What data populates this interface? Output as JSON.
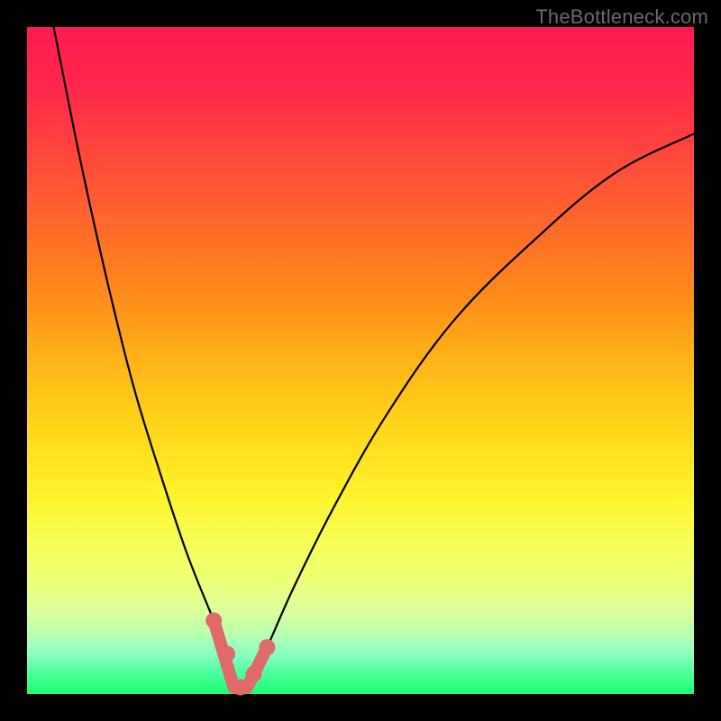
{
  "watermark": "TheBottleneck.com",
  "colors": {
    "background": "#000000",
    "curve": "#000000",
    "markers": "#e06a6a",
    "gradient_top": "#ff1a52",
    "gradient_mid": "#ffd61a",
    "gradient_bottom": "#1aff70"
  },
  "chart_data": {
    "type": "line",
    "title": "",
    "xlabel": "",
    "ylabel": "",
    "xlim": [
      0,
      100
    ],
    "ylim": [
      0,
      100
    ],
    "x_min_at": 32,
    "series": [
      {
        "name": "bottleneck-curve",
        "x": [
          4,
          8,
          12,
          16,
          20,
          24,
          28,
          30,
          32,
          34,
          36,
          40,
          46,
          54,
          64,
          76,
          88,
          100
        ],
        "values": [
          100,
          80,
          62,
          46,
          33,
          21,
          11,
          6,
          1,
          3,
          7,
          16,
          28,
          42,
          56,
          68,
          78,
          84
        ]
      }
    ],
    "markers": [
      {
        "x": 28,
        "y": 11
      },
      {
        "x": 30,
        "y": 6
      },
      {
        "x": 32,
        "y": 1
      },
      {
        "x": 34,
        "y": 3
      },
      {
        "x": 36,
        "y": 7
      }
    ],
    "marker_polyline": [
      {
        "x": 28,
        "y": 11
      },
      {
        "x": 31,
        "y": 1
      },
      {
        "x": 33,
        "y": 1
      },
      {
        "x": 36,
        "y": 7
      }
    ]
  }
}
